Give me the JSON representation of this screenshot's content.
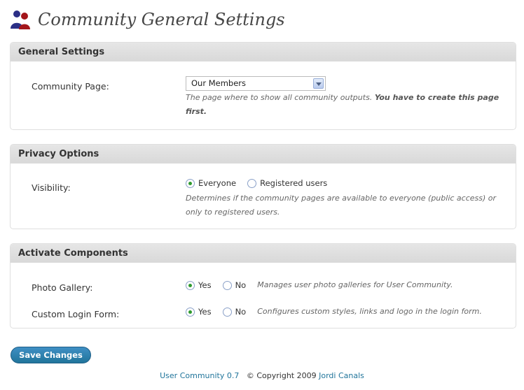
{
  "header": {
    "title": "Community General Settings",
    "icon": "users-icon"
  },
  "general": {
    "heading": "General Settings",
    "community_page_label": "Community Page:",
    "community_page_value": "Our Members",
    "community_page_desc": "The page where to show all community outputs.",
    "community_page_desc_bold": "You have to create this page first."
  },
  "privacy": {
    "heading": "Privacy Options",
    "visibility_label": "Visibility:",
    "options": [
      "Everyone",
      "Registered users"
    ],
    "selected": "Everyone",
    "desc": "Determines if the community pages are available to everyone (public access) or only to registered users."
  },
  "components": {
    "heading": "Activate Components",
    "items": [
      {
        "label": "Photo Gallery:",
        "yes": "Yes",
        "no": "No",
        "selected": "Yes",
        "desc": "Manages user photo galleries for User Community."
      },
      {
        "label": "Custom Login Form:",
        "yes": "Yes",
        "no": "No",
        "selected": "Yes",
        "desc": "Configures custom styles, links and logo in the login form."
      }
    ]
  },
  "save_button": "Save Changes",
  "footer": {
    "plugin_link": "User Community 0.7",
    "copyright": "© Copyright 2009",
    "author_link": "Jordi Canals"
  },
  "colors": {
    "accent": "#21759b",
    "radio_checked": "#2e9a2e",
    "panel_head": "#dfdfdf"
  }
}
